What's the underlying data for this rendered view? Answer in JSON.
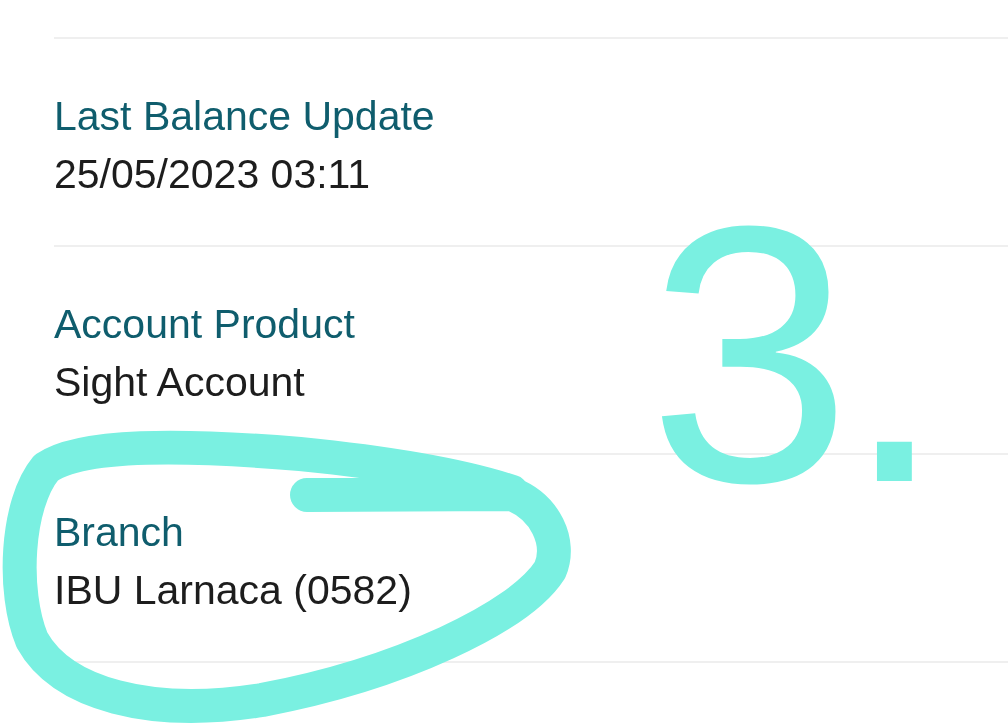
{
  "details": [
    {
      "label": "Last Balance Update",
      "value": "25/05/2023 03:11",
      "circled": false
    },
    {
      "label": "Account Product",
      "value": "Sight Account",
      "circled": false
    },
    {
      "label": "Branch",
      "value": "IBU Larnaca (0582)",
      "circled": true
    }
  ],
  "annotation": {
    "text": "3."
  }
}
